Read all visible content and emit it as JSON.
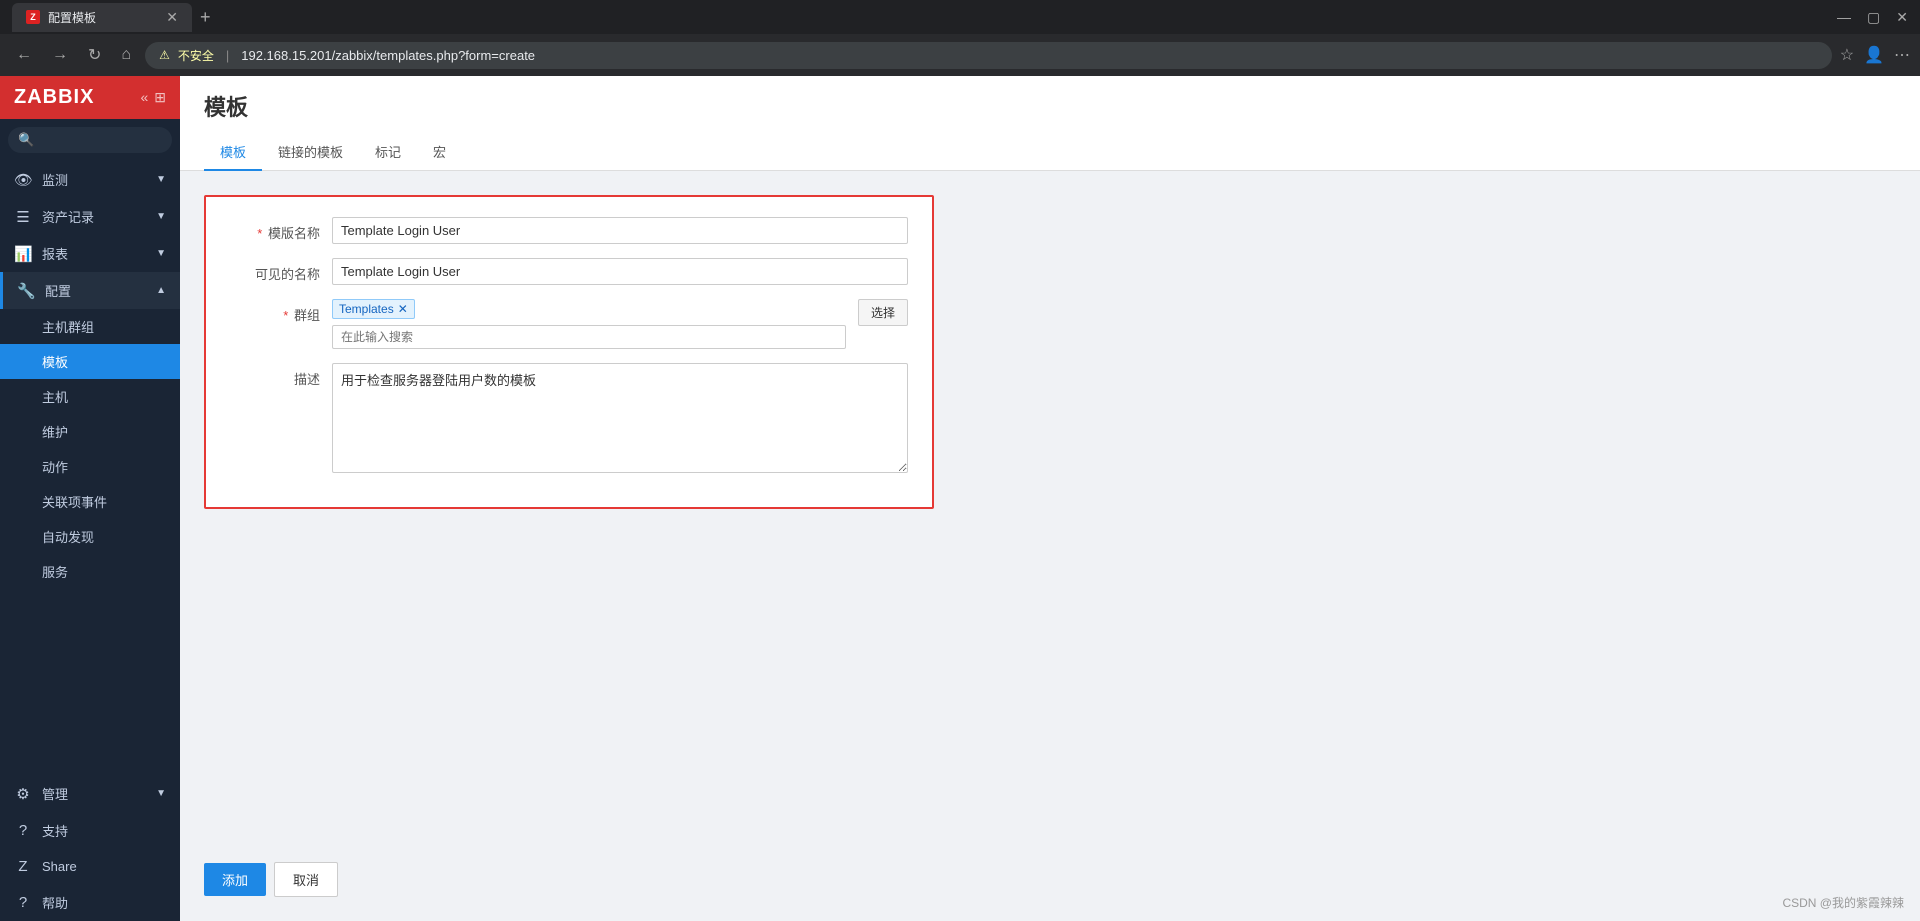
{
  "browser": {
    "tab_icon": "Z",
    "tab_title": "配置模板",
    "address": "192.168.15.201/zabbix/templates.php?form=create",
    "security_label": "不安全"
  },
  "sidebar": {
    "logo": "ZABBIX",
    "search_placeholder": "",
    "items": [
      {
        "id": "monitor",
        "label": "监测",
        "icon": "👁",
        "has_arrow": true
      },
      {
        "id": "assets",
        "label": "资产记录",
        "icon": "☰",
        "has_arrow": true
      },
      {
        "id": "reports",
        "label": "报表",
        "icon": "📊",
        "has_arrow": true
      },
      {
        "id": "config",
        "label": "配置",
        "icon": "🔧",
        "has_arrow": true,
        "active": true
      }
    ],
    "config_sub": [
      {
        "id": "host-group",
        "label": "主机群组"
      },
      {
        "id": "templates",
        "label": "模板",
        "active": true
      },
      {
        "id": "hosts",
        "label": "主机"
      },
      {
        "id": "maintenance",
        "label": "维护"
      },
      {
        "id": "actions",
        "label": "动作"
      },
      {
        "id": "correlation",
        "label": "关联项事件"
      },
      {
        "id": "discovery",
        "label": "自动发现"
      },
      {
        "id": "services",
        "label": "服务"
      }
    ],
    "bottom_items": [
      {
        "id": "admin",
        "label": "管理",
        "icon": "⚙",
        "has_arrow": true
      },
      {
        "id": "support",
        "label": "支持",
        "icon": "?"
      },
      {
        "id": "share",
        "label": "Share",
        "icon": "Z"
      },
      {
        "id": "help",
        "label": "帮助",
        "icon": "?"
      }
    ]
  },
  "page": {
    "title": "模板",
    "tabs": [
      {
        "id": "template",
        "label": "模板",
        "active": true
      },
      {
        "id": "linked-templates",
        "label": "链接的模板"
      },
      {
        "id": "tags",
        "label": "标记"
      },
      {
        "id": "macros",
        "label": "宏"
      }
    ]
  },
  "form": {
    "template_name_label": "模版名称",
    "template_name_value": "Template Login User",
    "visible_name_label": "可见的名称",
    "visible_name_value": "Template Login User",
    "groups_label": "群组",
    "groups_tag": "Templates",
    "groups_search_placeholder": "在此输入搜索",
    "select_button": "选择",
    "description_label": "描述",
    "description_value": "用于检查服务器登陆用户数的模板",
    "add_button": "添加",
    "cancel_button": "取消"
  },
  "footer": {
    "credit": "CSDN @我的紫霞辣辣"
  }
}
